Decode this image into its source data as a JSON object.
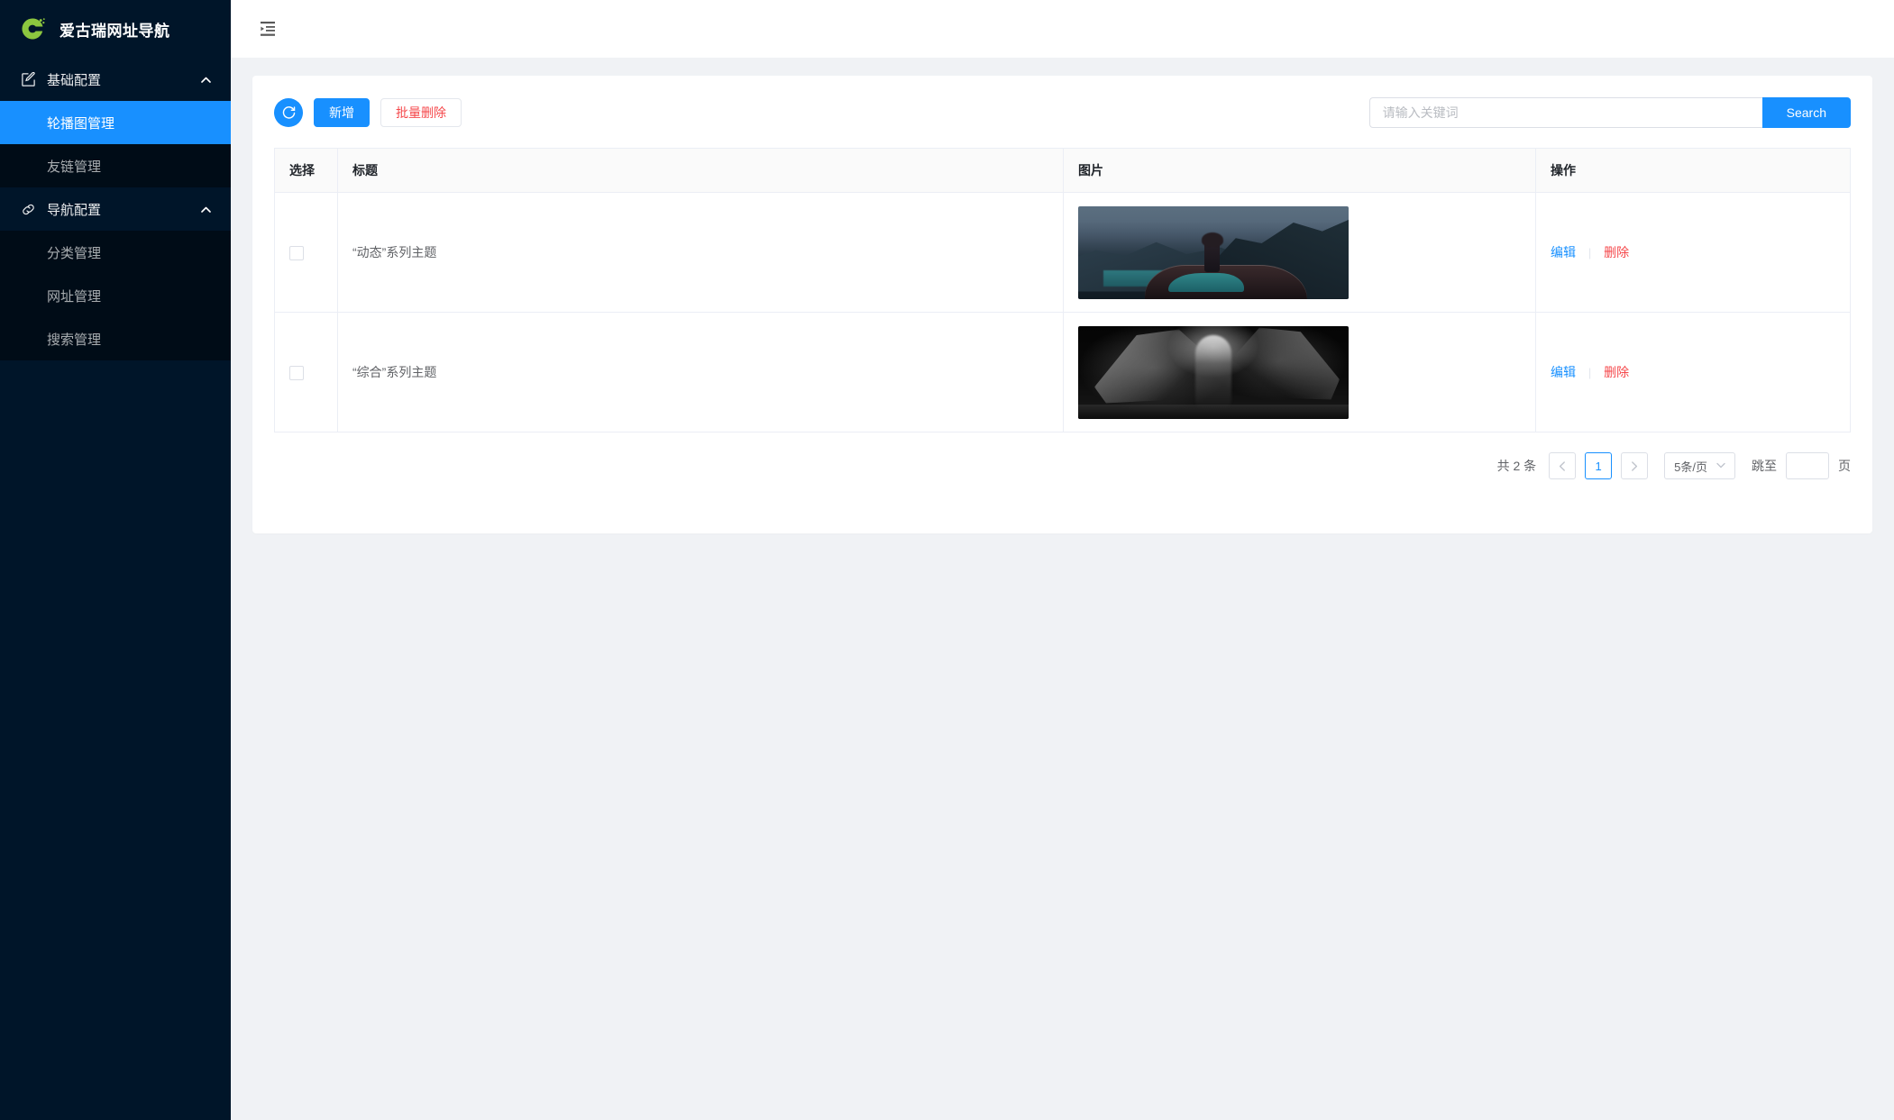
{
  "brand": {
    "title": "爱古瑞网址导航",
    "logo_icon": "green-g-logo-icon"
  },
  "sidebar": {
    "groups": [
      {
        "label": "基础配置",
        "icon": "form-edit-icon",
        "arrow_icon": "chevron-up-icon",
        "items": [
          {
            "label": "轮播图管理",
            "active": true
          },
          {
            "label": "友链管理",
            "active": false
          }
        ]
      },
      {
        "label": "导航配置",
        "icon": "link-chain-icon",
        "arrow_icon": "chevron-up-icon",
        "items": [
          {
            "label": "分类管理",
            "active": false
          },
          {
            "label": "网址管理",
            "active": false
          },
          {
            "label": "搜索管理",
            "active": false
          }
        ]
      }
    ]
  },
  "topbar": {
    "fold_icon": "menu-fold-icon"
  },
  "toolbar": {
    "refresh_icon": "refresh-circle-icon",
    "add_label": "新增",
    "batch_delete_label": "批量删除",
    "search_placeholder": "请输入关键词",
    "search_value": "",
    "search_button_label": "Search"
  },
  "table": {
    "columns": [
      "选择",
      "标题",
      "图片",
      "操作"
    ],
    "rows": [
      {
        "checked": false,
        "title": "“动态”系列主题",
        "image_alt": "dusk-lake-car-silhouette-thumbnail",
        "edit_label": "编辑",
        "delete_label": "删除"
      },
      {
        "checked": false,
        "title": "“综合”系列主题",
        "image_alt": "black-and-white-dramatic-thumbnail",
        "edit_label": "编辑",
        "delete_label": "删除"
      }
    ]
  },
  "pagination": {
    "total_text": "共 2 条",
    "prev_icon": "chevron-left-icon",
    "current_page": "1",
    "next_icon": "chevron-right-icon",
    "page_size_label": "5条/页",
    "page_size_caret": "chevron-down-icon",
    "jump_label": "跳至",
    "jump_value": "",
    "jump_suffix": "页"
  },
  "colors": {
    "sidebar_bg": "#001529",
    "submenu_bg": "#000c17",
    "accent": "#1890ff",
    "danger": "#f5484b",
    "page_bg": "#f0f2f5",
    "logo_green": "#8cc63f"
  }
}
